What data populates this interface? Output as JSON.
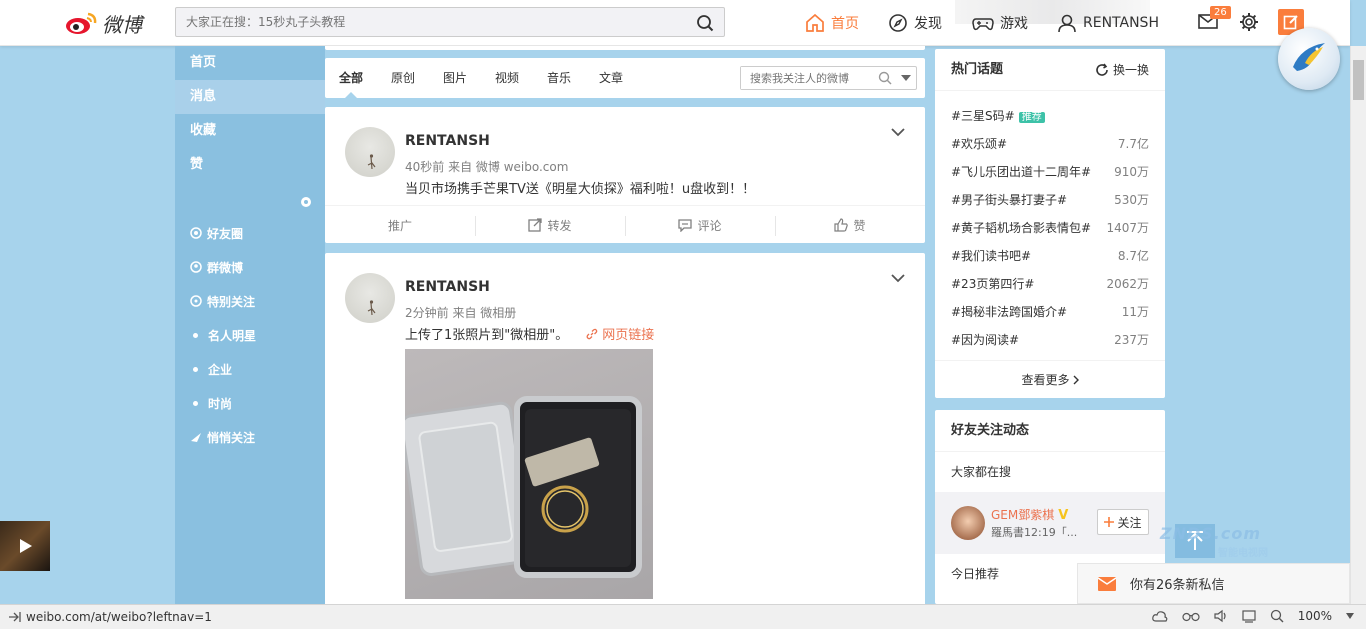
{
  "header": {
    "logo_text": "微博",
    "search_placeholder": "大家正在搜：15秒丸子头教程",
    "nav": {
      "home": "首页",
      "discover": "发现",
      "game": "游戏",
      "user": "RENTANSH"
    },
    "message_count": "26"
  },
  "sidebar": {
    "main": [
      "首页",
      "消息",
      "收藏",
      "赞"
    ],
    "active_index": 1,
    "groups": [
      {
        "label": "好友圈",
        "icon": "circle-icon"
      },
      {
        "label": "群微博",
        "icon": "group-icon"
      },
      {
        "label": "特别关注",
        "icon": "star-icon"
      },
      {
        "label": "名人明星",
        "icon": "dot"
      },
      {
        "label": "企业",
        "icon": "dot"
      },
      {
        "label": "时尚",
        "icon": "dot"
      },
      {
        "label": "悄悄关注",
        "icon": "whisper-icon"
      }
    ]
  },
  "tabs": {
    "items": [
      "全部",
      "原创",
      "图片",
      "视频",
      "音乐",
      "文章"
    ],
    "search_placeholder": "搜索我关注人的微博"
  },
  "posts": [
    {
      "user": "RENTANSH",
      "meta": "40秒前 来自 微博 weibo.com",
      "text": "当贝市场携手芒果TV送《明星大侦探》福利啦！u盘收到！！",
      "actions": {
        "promote": "推广",
        "repost": "转发",
        "comment": "评论",
        "like": "赞"
      }
    },
    {
      "user": "RENTANSH",
      "meta": "2分钟前 来自 微相册",
      "text": "上传了1张照片到\"微相册\"。",
      "link": "网页链接"
    }
  ],
  "hot_topics": {
    "title": "热门话题",
    "refresh": "换一换",
    "items": [
      {
        "name": "#三星S码#",
        "tag": "推荐",
        "count": ""
      },
      {
        "name": "#欢乐颂#",
        "tag": "",
        "count": "7.7亿"
      },
      {
        "name": "#飞儿乐团出道十二周年#",
        "tag": "",
        "count": "910万"
      },
      {
        "name": "#男子街头暴打妻子#",
        "tag": "",
        "count": "530万"
      },
      {
        "name": "#黄子韬机场合影表情包#",
        "tag": "",
        "count": "1407万"
      },
      {
        "name": "#我们读书吧#",
        "tag": "",
        "count": "8.7亿"
      },
      {
        "name": "#23页第四行#",
        "tag": "",
        "count": "2062万"
      },
      {
        "name": "#揭秘非法跨国婚介#",
        "tag": "",
        "count": "11万"
      },
      {
        "name": "#因为阅读#",
        "tag": "",
        "count": "237万"
      }
    ],
    "more": "查看更多"
  },
  "friends": {
    "title": "好友关注动态",
    "searching": "大家都在搜",
    "person": {
      "name": "GEM鄧紫棋",
      "info": "羅馬書12:19「...",
      "follow": "关注"
    },
    "today": "今日推荐"
  },
  "notification": "你有26条新私信",
  "watermark": {
    "text": "ZNDS.com",
    "sub": "智能电视网"
  },
  "statusbar": {
    "url": "weibo.com/at/weibo?leftnav=1",
    "zoom": "100%"
  },
  "colors": {
    "accent": "#fa7d3c",
    "sidebar": "#8ac0e0",
    "background": "#a7d3ec"
  }
}
